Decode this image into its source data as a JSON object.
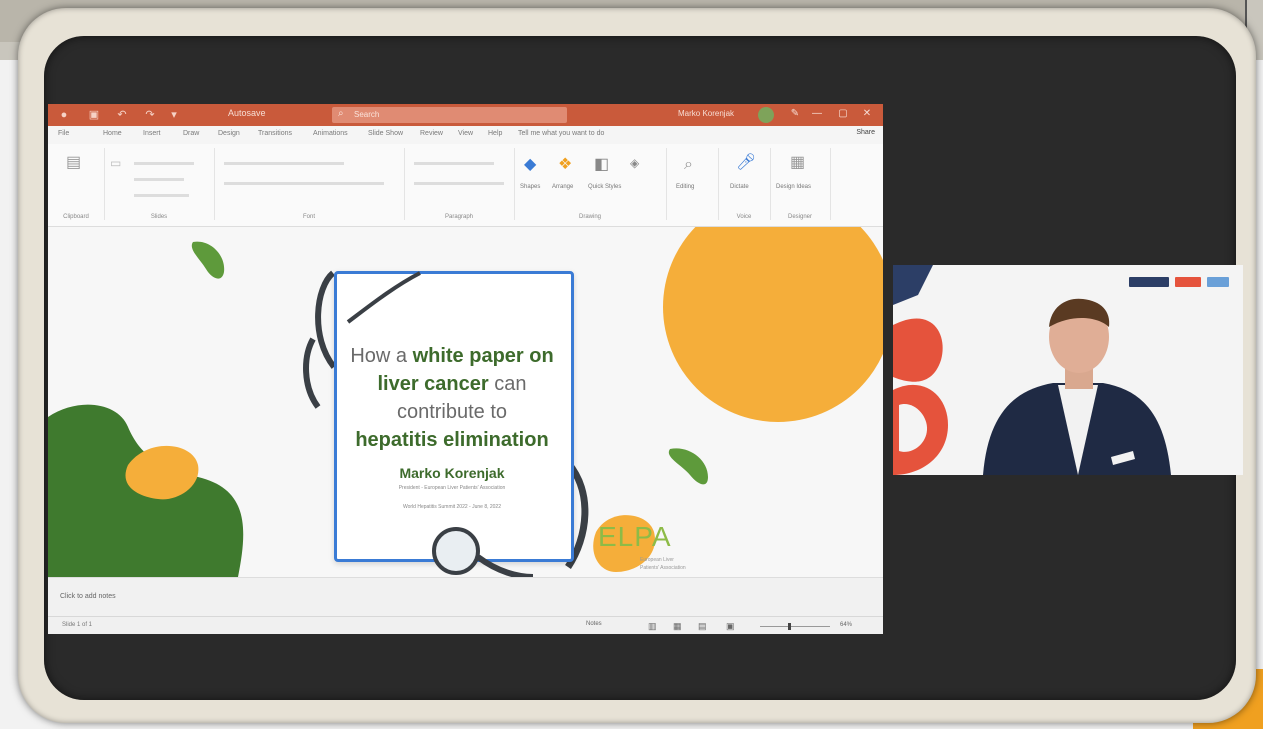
{
  "ppt": {
    "window": {
      "filename": "Autosave",
      "search_placeholder": "Search",
      "user_name": "Marko Korenjak",
      "min": "—",
      "max": "▢",
      "close": "✕"
    },
    "tabs": [
      "File",
      "Home",
      "Insert",
      "Draw",
      "Design",
      "Transitions",
      "Animations",
      "Slide Show",
      "Review",
      "View",
      "Help",
      "Tell me what you want to do"
    ],
    "share_label": "Share",
    "ribbon": {
      "groups": [
        "Clipboard",
        "Slides",
        "Font",
        "Paragraph",
        "Drawing",
        "Editing",
        "Voice",
        "Designer"
      ],
      "drawing": {
        "shapes": "Shapes",
        "arrange": "Arrange",
        "quick_styles": "Quick Styles"
      },
      "editing_label": "Editing",
      "dictate_label": "Dictate",
      "design_ideas_label": "Design Ideas"
    },
    "slide": {
      "title_part1": "How a ",
      "title_bold1": "white paper on",
      "title_bold2": "liver cancer",
      "title_part2": " can",
      "title_part3": "contribute to",
      "title_bold3": "hepatitis elimination",
      "author": "Marko Korenjak",
      "subtitle1": "President - European Liver Patients' Association",
      "subtitle2": "World Hepatitis Summit 2022 - June 8, 2022",
      "logo_text": "ELPA",
      "logo_sub1": "European Liver",
      "logo_sub2": "Patients' Association"
    },
    "notes_placeholder": "Click to add notes",
    "status": {
      "left": "Slide 1 of 1",
      "notes_button": "Notes",
      "zoom": "64%"
    }
  },
  "colors": {
    "title_bar": "#c95a3b",
    "paper_border": "#3a7bd5",
    "green": "#3d6b2c",
    "orange": "#f5ae3a",
    "red": "#e5533c",
    "navy": "#2c3e66"
  }
}
